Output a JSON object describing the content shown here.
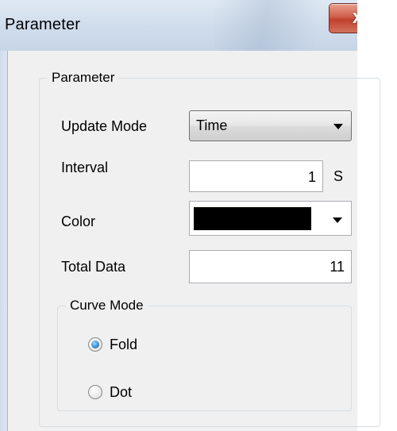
{
  "window": {
    "title": "Parameter",
    "close_glyph": "x"
  },
  "parameter_group": {
    "legend": "Parameter",
    "update_mode": {
      "label": "Update Mode",
      "value": "Time"
    },
    "interval": {
      "label": "Interval",
      "value": "1",
      "unit": "S"
    },
    "color": {
      "label": "Color",
      "swatch": "#000000"
    },
    "total_data": {
      "label": "Total Data",
      "value": "11"
    }
  },
  "curve_mode_group": {
    "legend": "Curve Mode",
    "options": [
      {
        "label": "Fold",
        "checked": true
      },
      {
        "label": "Dot",
        "checked": false
      }
    ]
  },
  "colors": {
    "title_bar": "#cfdceb",
    "client_background": "#f0f0f0",
    "close_button": "#c0402c",
    "radio_selected": "#3c8fd0"
  }
}
